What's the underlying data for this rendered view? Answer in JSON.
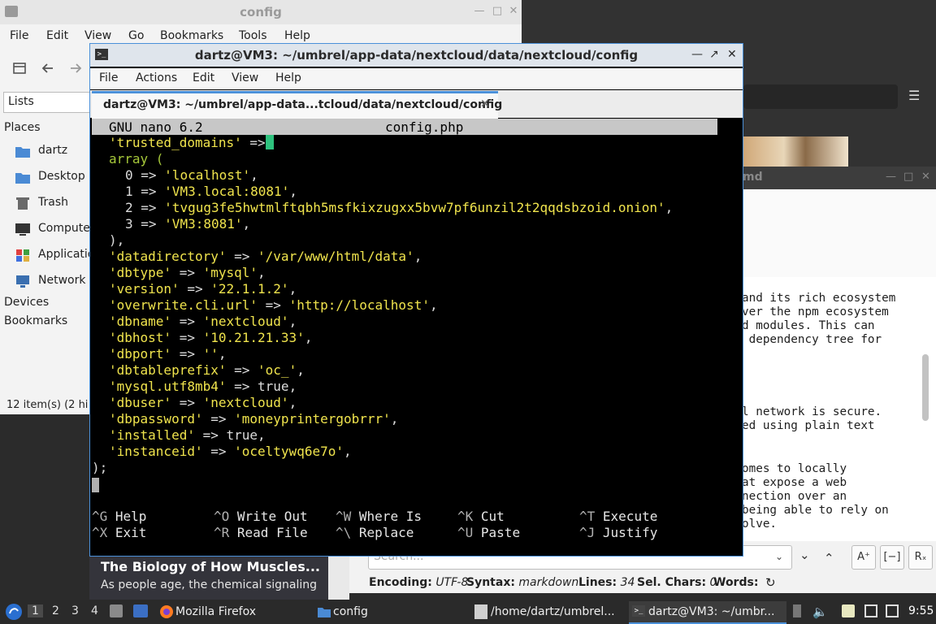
{
  "file_manager": {
    "title": "config",
    "menu": [
      "File",
      "Edit",
      "View",
      "Go",
      "Bookmarks",
      "Tools",
      "Help"
    ],
    "lists_label": "Lists",
    "places_heading": "Places",
    "places": [
      "dartz",
      "Desktop",
      "Trash",
      "Compute",
      "Applicatio",
      "Network"
    ],
    "devices_heading": "Devices",
    "bookmarks_heading": "Bookmarks",
    "status": "12 item(s) (2 hi"
  },
  "terminal": {
    "title": "dartz@VM3: ~/umbrel/app-data/nextcloud/data/nextcloud/config",
    "menu": [
      "File",
      "Actions",
      "Edit",
      "View",
      "Help"
    ],
    "tab_label": "dartz@VM3: ~/umbrel/app-data...tcloud/data/nextcloud/config",
    "nano": {
      "version": "GNU nano 6.2",
      "filename": "config.php",
      "shortcuts": [
        {
          "key": "^G",
          "label": "Help"
        },
        {
          "key": "^O",
          "label": "Write Out"
        },
        {
          "key": "^W",
          "label": "Where Is"
        },
        {
          "key": "^K",
          "label": "Cut"
        },
        {
          "key": "^T",
          "label": "Execute"
        },
        {
          "key": "^X",
          "label": "Exit"
        },
        {
          "key": "^R",
          "label": "Read File"
        },
        {
          "key": "^\\",
          "label": "Replace"
        },
        {
          "key": "^U",
          "label": "Paste"
        },
        {
          "key": "^J",
          "label": "Justify"
        }
      ]
    }
  },
  "config_lines": {
    "l1k": "'trusted_domains'",
    "l1o": " =>",
    "l2": "array (",
    "l3i": "0 =>",
    "l3v": "'localhost'",
    "l3e": ",",
    "l4i": "1 =>",
    "l4v": "'VM3.local:8081'",
    "l4e": ",",
    "l5i": "2 =>",
    "l5v": "'tvgug3fe5hwtmlftqbh5msfkixzugxx5bvw7pf6unzil2t2qqdsbzoid.onion'",
    "l5e": ",",
    "l6i": "3 =>",
    "l6v": "'VM3:8081'",
    "l6e": ",",
    "l7": "),",
    "l8k": "'datadirectory'",
    "l8o": " => ",
    "l8v": "'/var/www/html/data'",
    "l8e": ",",
    "l9k": "'dbtype'",
    "l9o": " => ",
    "l9v": "'mysql'",
    "l9e": ",",
    "l10k": "'version'",
    "l10o": " => ",
    "l10v": "'22.1.1.2'",
    "l10e": ",",
    "l11k": "'overwrite.cli.url'",
    "l11o": " => ",
    "l11v": "'http://localhost'",
    "l11e": ",",
    "l12k": "'dbname'",
    "l12o": " => ",
    "l12v": "'nextcloud'",
    "l12e": ",",
    "l13k": "'dbhost'",
    "l13o": " => ",
    "l13v": "'10.21.21.33'",
    "l13e": ",",
    "l14k": "'dbport'",
    "l14o": " => ",
    "l14v": "''",
    "l14e": ",",
    "l15k": "'dbtableprefix'",
    "l15o": " => ",
    "l15v": "'oc_'",
    "l15e": ",",
    "l16k": "'mysql.utf8mb4'",
    "l16o": " => ",
    "l16v": "true",
    "l16e": ",",
    "l17k": "'dbuser'",
    "l17o": " => ",
    "l17v": "'nextcloud'",
    "l17e": ",",
    "l18k": "'dbpassword'",
    "l18o": " => ",
    "l18v": "'moneyprintergobrrr'",
    "l18e": ",",
    "l19k": "'installed'",
    "l19o": " => ",
    "l19v": "true",
    "l19e": ",",
    "l20k": "'instanceid'",
    "l20o": " => ",
    "l20v": "'oceltywq6e7o'",
    "l20e": ",",
    "l21": ");"
  },
  "text_editor": {
    "title_fragment": "md",
    "body_lines": [
      "and its rich ecosystem",
      "ver the npm ecosystem",
      "d modules. This can",
      " dependency tree for",
      "",
      "",
      "",
      "l network is secure.",
      "ed using plain text",
      "",
      "",
      "omes to locally",
      "at expose a web",
      "nection over an",
      "being able to rely on",
      "olve."
    ],
    "search_placeholder": "Search...",
    "status": {
      "encoding_label": "Encoding:",
      "encoding": "UTF-8",
      "syntax_label": "Syntax:",
      "syntax": "markdown",
      "lines_label": "Lines:",
      "lines": "34",
      "sel_label": "Sel. Chars:",
      "sel": "0",
      "words_label": "Words:"
    }
  },
  "firefox_snippet": {
    "heading": "The Biology of How Muscles...",
    "text": "As people age, the chemical signaling"
  },
  "panel": {
    "workspaces": [
      "1",
      "2",
      "3",
      "4"
    ],
    "tasks": [
      "Mozilla Firefox",
      "config",
      "/home/dartz/umbrel...",
      "dartz@VM3: ~/umbr..."
    ],
    "clock": "9:55"
  },
  "colors": {
    "terminal_yellow": "#f0e44d",
    "terminal_green": "#a6c83a",
    "accent": "#4a90d9"
  }
}
